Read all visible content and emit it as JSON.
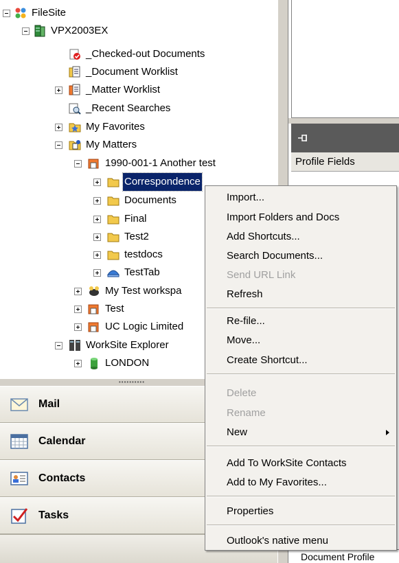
{
  "tree": {
    "root": "FileSite",
    "server": "VPX2003EX",
    "checked_out": "_Checked-out Documents",
    "doc_worklist": "_Document Worklist",
    "matter_worklist": "_Matter Worklist",
    "recent_searches": "_Recent Searches",
    "my_favorites": "My Favorites",
    "my_matters": "My Matters",
    "matter": "1990-001-1 Another test",
    "folders": [
      "Correspondence",
      "Documents",
      "Final",
      "Test2",
      "testdocs"
    ],
    "test_tab": "TestTab",
    "my_test_workspace": "My Test workspa",
    "test": "Test",
    "uc_logic": "UC Logic Limited",
    "worksite_explorer": "WorkSite Explorer",
    "london": "LONDON"
  },
  "right_pane": {
    "profile_fields": "Profile Fields",
    "document_profile": "Document Profile"
  },
  "nav": {
    "mail": "Mail",
    "calendar": "Calendar",
    "contacts": "Contacts",
    "tasks": "Tasks"
  },
  "context_menu": {
    "import": "Import...",
    "import_folders": "Import Folders and Docs",
    "add_shortcuts": "Add Shortcuts...",
    "search_documents": "Search Documents...",
    "send_url": "Send URL Link",
    "refresh": "Refresh",
    "refile": "Re-file...",
    "move": "Move...",
    "create_shortcut": "Create Shortcut...",
    "delete": "Delete",
    "rename": "Rename",
    "new": "New",
    "add_contacts": "Add To WorkSite Contacts",
    "add_favorites": "Add to My Favorites...",
    "properties": "Properties",
    "native_menu": "Outlook's native menu"
  },
  "colors": {
    "selection": "#0a246a",
    "menu_bg": "#f3f1ed",
    "folder": "#f2c94c",
    "disabled_text": "#a0a0a0"
  },
  "icons": [
    "filesite-icon",
    "server-icon",
    "checked-out-icon",
    "worklist-icon",
    "matter-worklist-icon",
    "recent-searches-icon",
    "favorites-icon",
    "matters-icon",
    "matter-icon",
    "folder-icon",
    "tab-icon",
    "workspace-icon",
    "explorer-icon",
    "database-icon",
    "mail-icon",
    "calendar-icon",
    "contacts-icon",
    "tasks-icon",
    "pin-icon"
  ]
}
